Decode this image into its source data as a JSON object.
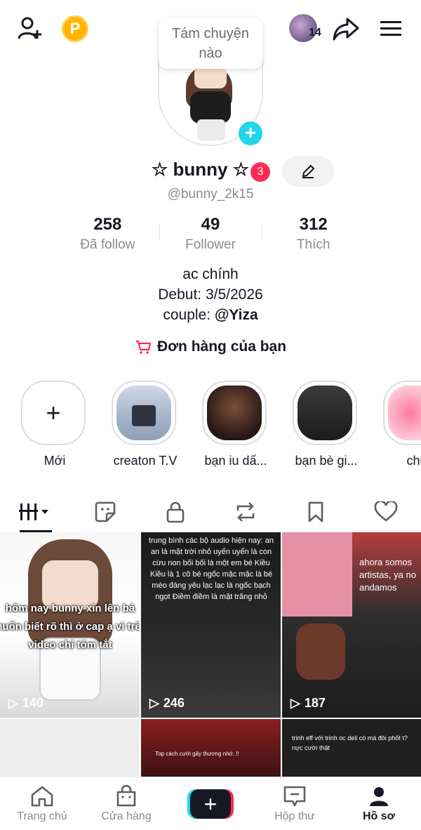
{
  "topbar": {
    "points_label": "P",
    "friend_count": "14"
  },
  "bubble": {
    "text": "Tám chuyện nào"
  },
  "profile": {
    "display_name": "☆ bunny ☆",
    "notification_count": "3",
    "handle": "@bunny_2k15"
  },
  "stats": [
    {
      "value": "258",
      "label": "Đã follow"
    },
    {
      "value": "49",
      "label": "Follower"
    },
    {
      "value": "312",
      "label": "Thích"
    }
  ],
  "bio": {
    "line1": "ac chính",
    "line2": "Debut: 3/5/2026",
    "line3_prefix": "couple: ",
    "line3_mention": "@Yiza"
  },
  "orders": {
    "label": "Đơn hàng của bạn"
  },
  "highlights": [
    {
      "label": "Mới"
    },
    {
      "label": "creaton T.V"
    },
    {
      "label": "bạn iu dấ..."
    },
    {
      "label": "bạn bè gi..."
    },
    {
      "label": "chu"
    }
  ],
  "videos": [
    {
      "views": "140",
      "overlay": "hôm nay bunny xin lên bả muốn biết rõ thì ở cap ạ vì trên video chỉ tóm tắt"
    },
    {
      "views": "246",
      "overlay": "trung bình các bộ audio hiện nay: an an là mặt trời nhỏ uyển uyển là con cừu non bối bối là một em bé Kiều Kiều là 1 cô bé ngốc mặc mặc là bé mèo đáng yêu lạc lạc là ngốc bạch ngọt Điềm điềm là mặt trăng nhỏ"
    },
    {
      "views": "187",
      "overlay": "ahora somos artistas, ya no andamos"
    },
    {
      "views": "",
      "overlay": ""
    },
    {
      "views": "",
      "overlay": "Top cách cười gây thương nhớ..!!"
    },
    {
      "views": "",
      "overlay": "trinh eff với trinh oc deli có mà đòi phốt t? nực cười thật"
    }
  ],
  "bottom_nav": [
    {
      "label": "Trang chủ"
    },
    {
      "label": "Cửa hàng"
    },
    {
      "label": ""
    },
    {
      "label": "Hộp thư"
    },
    {
      "label": "Hồ sơ"
    }
  ],
  "colors": {
    "accent_red": "#fe2c55",
    "accent_cyan": "#20d5ec",
    "points": "#ffb400",
    "text_primary": "#161823",
    "text_secondary": "#8a8b91"
  }
}
